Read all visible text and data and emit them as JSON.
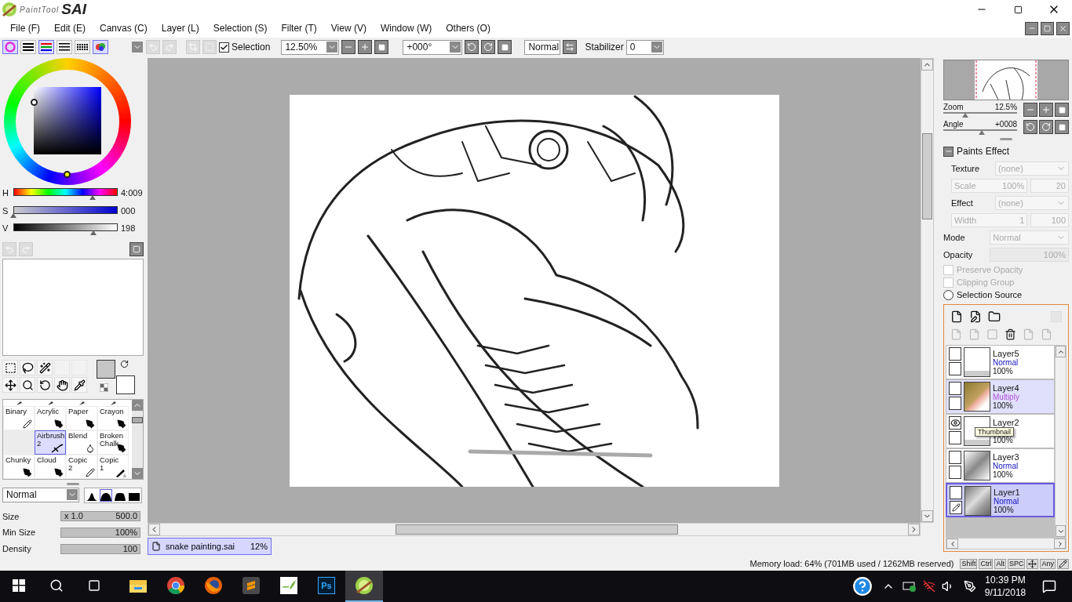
{
  "window": {
    "logo_script": "PaintTool",
    "logo_mark": "SAI"
  },
  "menu": [
    "File (F)",
    "Edit (E)",
    "Canvas (C)",
    "Layer (L)",
    "Selection (S)",
    "Filter (T)",
    "View (V)",
    "Window (W)",
    "Others (O)"
  ],
  "color_modes": [
    {
      "kind": "wheel",
      "selected": true
    },
    {
      "kind": "bars",
      "selected": false
    },
    {
      "kind": "rgb",
      "selected": true
    },
    {
      "kind": "list",
      "selected": false
    },
    {
      "kind": "grid",
      "selected": false
    },
    {
      "kind": "swatch",
      "selected": true
    }
  ],
  "toolbar": {
    "selection": {
      "label": "Selection",
      "checked": true
    },
    "zoom": "12.50%",
    "angle": "+000°",
    "blend": "Normal",
    "stabilizer_label": "Stabilizer",
    "stabilizer": "0"
  },
  "hsv": [
    {
      "label": "H",
      "value": "4:009",
      "level": 0.76
    },
    {
      "label": "S",
      "value": "000",
      "level": 0
    },
    {
      "label": "V",
      "value": "198",
      "level": 0.77
    }
  ],
  "brushes": [
    {
      "kind": "pencil",
      "name": "Binary",
      "selected": false
    },
    {
      "kind": "pen",
      "name": "Acrylic",
      "selected": false
    },
    {
      "kind": "pen",
      "name": "Paper",
      "selected": false
    },
    {
      "kind": "pen",
      "name": "Crayon",
      "selected": false
    },
    {
      "kind": "empty",
      "selected": false
    },
    {
      "kind": "airbrush",
      "name": "Airbrush 2",
      "selected": true
    },
    {
      "kind": "blend",
      "name": "Blend",
      "selected": false
    },
    {
      "kind": "pen",
      "name": "Broken Chalk",
      "selected": false
    },
    {
      "kind": "pen",
      "name": "Chunky",
      "selected": false
    },
    {
      "kind": "pen",
      "name": "Cloud",
      "selected": false
    },
    {
      "kind": "pencil",
      "name": "Copic 2",
      "selected": false
    },
    {
      "kind": "marker",
      "name": "Copic 1",
      "selected": false
    }
  ],
  "brush_mode": "Normal",
  "brush_shapes": [
    {
      "kind": "cone",
      "selected": false
    },
    {
      "kind": "dome",
      "selected": true
    },
    {
      "kind": "flat",
      "selected": false
    },
    {
      "kind": "block",
      "selected": false
    }
  ],
  "brush_params": [
    {
      "label": "Size",
      "multiplier": "x 1.0",
      "value": "500.0",
      "level": 1
    },
    {
      "label": "Min Size",
      "value": "100%",
      "level": 1
    },
    {
      "label": "Density",
      "value": "100",
      "level": 1
    }
  ],
  "navigator": {
    "zoom": {
      "label": "Zoom",
      "value": "12.5%",
      "level": 0.3
    },
    "angle": {
      "label": "Angle",
      "value": "+0008",
      "level": 0.52
    }
  },
  "paints_effect": {
    "title": "Paints Effect",
    "expanded": true,
    "texture": {
      "label": "Texture",
      "value": "(none)"
    },
    "scale": {
      "label": "Scale",
      "value": "100%",
      "amount": "20"
    },
    "effect": {
      "label": "Effect",
      "value": "(none)"
    },
    "width": {
      "label": "Width",
      "value": "1",
      "amount": "100"
    }
  },
  "layer_props": {
    "mode_label": "Mode",
    "mode": "Normal",
    "opacity": {
      "label": "Opacity",
      "value": "100%",
      "level": 1
    },
    "options": [
      {
        "kind": "checkbox",
        "label": "Preserve Opacity",
        "checked": false,
        "disabled": true
      },
      {
        "kind": "checkbox",
        "label": "Clipping Group",
        "checked": false,
        "disabled": true
      },
      {
        "kind": "radio",
        "label": "Selection Source",
        "checked": false,
        "disabled": false
      }
    ]
  },
  "layers": [
    {
      "name": "Layer5",
      "kind": "blank",
      "mode": "Normal",
      "tinted": false,
      "opacity": "100%",
      "visible": false,
      "editing": false,
      "selected": false,
      "highlighted": false
    },
    {
      "name": "Layer4",
      "kind": "color",
      "mode": "Multiply",
      "tinted": true,
      "opacity": "100%",
      "visible": false,
      "editing": false,
      "selected": false,
      "highlighted": true
    },
    {
      "name": "Layer2",
      "kind": "sketch",
      "opacity": "100%",
      "visible": true,
      "editing": false,
      "selected": false,
      "highlighted": false,
      "tooltip": "Thumbnail"
    },
    {
      "name": "Layer3",
      "kind": "gray",
      "mode": "Normal",
      "tinted": false,
      "opacity": "100%",
      "visible": false,
      "editing": false,
      "selected": false,
      "highlighted": false
    },
    {
      "name": "Layer1",
      "kind": "blur",
      "mode": "Normal",
      "tinted": false,
      "opacity": "100%",
      "visible": false,
      "editing": true,
      "selected": true,
      "highlighted": false
    }
  ],
  "document": {
    "name": "snake painting.sai",
    "zoom": "12%",
    "selected": true
  },
  "status": {
    "memory": "Memory load: 64% (701MB used / 1262MB reserved)",
    "keys": [
      {
        "kind": "text",
        "label": "Shift"
      },
      {
        "kind": "text",
        "label": "Ctrl"
      },
      {
        "kind": "text",
        "label": "Alt"
      },
      {
        "kind": "text",
        "label": "SPC"
      },
      {
        "kind": "move"
      },
      {
        "kind": "text",
        "label": "Any"
      },
      {
        "kind": "pen"
      }
    ]
  },
  "taskbar": {
    "apps": [
      {
        "kind": "folder",
        "selected": false
      },
      {
        "kind": "chrome",
        "selected": false
      },
      {
        "kind": "firefox",
        "selected": false
      },
      {
        "kind": "sublime",
        "selected": false
      },
      {
        "kind": "leaf",
        "selected": false
      },
      {
        "kind": "ps",
        "label": "Ps",
        "selected": false
      },
      {
        "kind": "sai",
        "selected": true
      }
    ],
    "time": "10:39 PM",
    "date": "9/11/2018"
  }
}
